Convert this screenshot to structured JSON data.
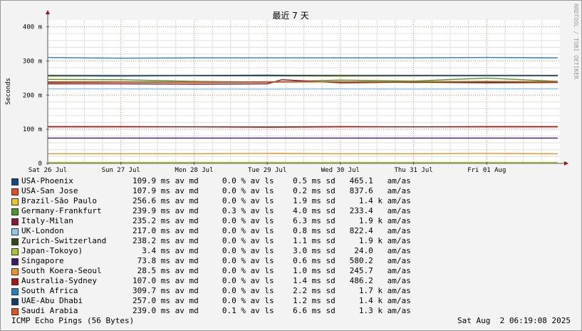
{
  "chart_data": {
    "type": "line",
    "title": "最近 7 天",
    "ylabel": "Seconds",
    "vertical_label": "RRDTOOL / TOBI OETIKER",
    "ylim": [
      0,
      420
    ],
    "xlim": [
      0,
      7.0
    ],
    "y_ticks": [
      {
        "value": 0,
        "label": "0"
      },
      {
        "value": 100,
        "label": "100 m"
      },
      {
        "value": 200,
        "label": "200 m"
      },
      {
        "value": 300,
        "label": "300 m"
      },
      {
        "value": 400,
        "label": "400 m"
      }
    ],
    "x_ticks": [
      {
        "value": 0,
        "label": "Sat 26 Jul"
      },
      {
        "value": 1,
        "label": "Sun 27 Jul"
      },
      {
        "value": 2,
        "label": "Mon 28 Jul"
      },
      {
        "value": 3,
        "label": "Tue 29 Jul"
      },
      {
        "value": 4,
        "label": "Wed 30 Jul"
      },
      {
        "value": 5,
        "label": "Thu 31 Jul"
      },
      {
        "value": 6,
        "label": "Fri 01 Aug"
      }
    ],
    "grid": true,
    "series": [
      {
        "name": "USA-Phoenix",
        "color": "#0b4a8c",
        "values": [
          [
            0,
            257
          ],
          [
            1,
            257
          ],
          [
            2,
            257
          ],
          [
            3,
            258
          ],
          [
            4,
            257
          ],
          [
            5,
            257
          ],
          [
            6,
            257
          ],
          [
            6.97,
            257
          ]
        ],
        "stats": "109.9 ms av md     0.0 % av ls    0.5 ms sd   465.1   am/as"
      },
      {
        "name": "USA-San Jose",
        "color": "#e8491d",
        "values": [
          [
            0,
            108
          ],
          [
            1,
            108
          ],
          [
            2,
            107
          ],
          [
            3,
            107
          ],
          [
            4,
            108
          ],
          [
            5,
            107
          ],
          [
            6,
            108
          ],
          [
            6.97,
            108
          ]
        ],
        "stats": "107.9 ms av md     0.0 % av ls    0.2 ms sd   837.6   am/as"
      },
      {
        "name": "Brazil-São Paulo",
        "color": "#f0c808",
        "values": [
          [
            0,
            255
          ],
          [
            1,
            256
          ],
          [
            2,
            257
          ],
          [
            3,
            256
          ],
          [
            4,
            255
          ],
          [
            5,
            256
          ],
          [
            6,
            257
          ],
          [
            6.97,
            256
          ]
        ],
        "stats": "256.6 ms av md     0.0 % av ls    1.9 ms sd     1.4 k am/as"
      },
      {
        "name": "Germany-Frankfurt",
        "color": "#4b9a1e",
        "values": [
          [
            0,
            246
          ],
          [
            1,
            245
          ],
          [
            2,
            240
          ],
          [
            3,
            238
          ],
          [
            4,
            244
          ],
          [
            5,
            241
          ],
          [
            6,
            250
          ],
          [
            6.97,
            240
          ]
        ],
        "stats": "239.9 ms av md     0.3 % av ls    4.0 ms sd   233.4   am/as"
      },
      {
        "name": "Italy-Milan",
        "color": "#8a1538",
        "values": [
          [
            0,
            233
          ],
          [
            1,
            233
          ],
          [
            2,
            232
          ],
          [
            3,
            233
          ],
          [
            3.2,
            245
          ],
          [
            4,
            236
          ],
          [
            5,
            238
          ],
          [
            6,
            236
          ],
          [
            6.97,
            237
          ]
        ],
        "stats": "235.2 ms av md     0.0 % av ls    6.3 ms sd     1.9 k am/as"
      },
      {
        "name": "UK-London",
        "color": "#8ccaf0",
        "values": [
          [
            0,
            218
          ],
          [
            1,
            218
          ],
          [
            2,
            217
          ],
          [
            3,
            217
          ],
          [
            4,
            218
          ],
          [
            5,
            217
          ],
          [
            6,
            218
          ],
          [
            6.97,
            218
          ]
        ],
        "stats": "217.0 ms av md     0.0 % av ls    0.8 ms sd   822.4   am/as"
      },
      {
        "name": "Zurich-Switzerland",
        "color": "#2f4a12",
        "values": [
          [
            0,
            237
          ],
          [
            1,
            238
          ],
          [
            2,
            237
          ],
          [
            3,
            238
          ],
          [
            4,
            239
          ],
          [
            5,
            237
          ],
          [
            6,
            238
          ],
          [
            6.97,
            238
          ]
        ],
        "stats": "238.2 ms av md     0.0 % av ls    1.1 ms sd     1.9 k am/as"
      },
      {
        "name": "Japan-Tokoyo)",
        "color": "#a8c81e",
        "values": [
          [
            0,
            3
          ],
          [
            1,
            3
          ],
          [
            2,
            3
          ],
          [
            3,
            3
          ],
          [
            4,
            3
          ],
          [
            5,
            3
          ],
          [
            6,
            3
          ],
          [
            6.97,
            3
          ]
        ],
        "stats": "  3.4 ms av md     0.0 % av ls    3.0 ms sd    24.0   am/as"
      },
      {
        "name": "Singapore",
        "color": "#3c1a6a",
        "values": [
          [
            0,
            74
          ],
          [
            1,
            74
          ],
          [
            2,
            74
          ],
          [
            3,
            74
          ],
          [
            4,
            74
          ],
          [
            5,
            74
          ],
          [
            6,
            74
          ],
          [
            6.97,
            74
          ]
        ],
        "stats": " 73.8 ms av md     0.0 % av ls    0.6 ms sd   580.2   am/as"
      },
      {
        "name": "South Koera-Seoul",
        "color": "#f0931e",
        "values": [
          [
            0,
            28
          ],
          [
            1,
            28
          ],
          [
            2,
            28
          ],
          [
            3,
            29
          ],
          [
            4,
            28
          ],
          [
            5,
            28
          ],
          [
            6,
            29
          ],
          [
            6.97,
            28
          ]
        ],
        "stats": " 28.5 ms av md     0.0 % av ls    1.0 ms sd   245.7   am/as"
      },
      {
        "name": "Australia-Sydney",
        "color": "#b00f0f",
        "values": [
          [
            0,
            107
          ],
          [
            1,
            107
          ],
          [
            2,
            107
          ],
          [
            3,
            106
          ],
          [
            4,
            107
          ],
          [
            5,
            107
          ],
          [
            6,
            107
          ],
          [
            6.97,
            107
          ]
        ],
        "stats": "107.0 ms av md     0.0 % av ls    1.4 ms sd   486.2   am/as"
      },
      {
        "name": "South Africa",
        "color": "#1e82c8",
        "values": [
          [
            0,
            310
          ],
          [
            1,
            308
          ],
          [
            2,
            309
          ],
          [
            3,
            309
          ],
          [
            4,
            309
          ],
          [
            5,
            309
          ],
          [
            6,
            310
          ],
          [
            6.97,
            309
          ]
        ],
        "stats": "309.7 ms av md     0.0 % av ls    2.2 ms sd     1.7 k am/as"
      },
      {
        "name": "UAE-Abu Dhabi",
        "color": "#0d3f6e",
        "values": [
          [
            0,
            257
          ],
          [
            1,
            256
          ],
          [
            2,
            257
          ],
          [
            3,
            257
          ],
          [
            4,
            257
          ],
          [
            5,
            257
          ],
          [
            6,
            257
          ],
          [
            6.97,
            257
          ]
        ],
        "stats": "257.0 ms av md     0.0 % av ls    1.2 ms sd     1.4 k am/as"
      },
      {
        "name": "Saudi Arabia",
        "color": "#e8521a",
        "values": [
          [
            0,
            239
          ],
          [
            1,
            239
          ],
          [
            2,
            238
          ],
          [
            3,
            239
          ],
          [
            4,
            239
          ],
          [
            5,
            239
          ],
          [
            6,
            240
          ],
          [
            6.97,
            239
          ]
        ],
        "stats": "239.0 ms av md     0.1 % av ls    6.6 ms sd     1.3 k am/as"
      }
    ]
  },
  "footer": {
    "left": "ICMP Echo Pings (56 Bytes)",
    "right": "Sat Aug  2 06:19:08 2025"
  }
}
